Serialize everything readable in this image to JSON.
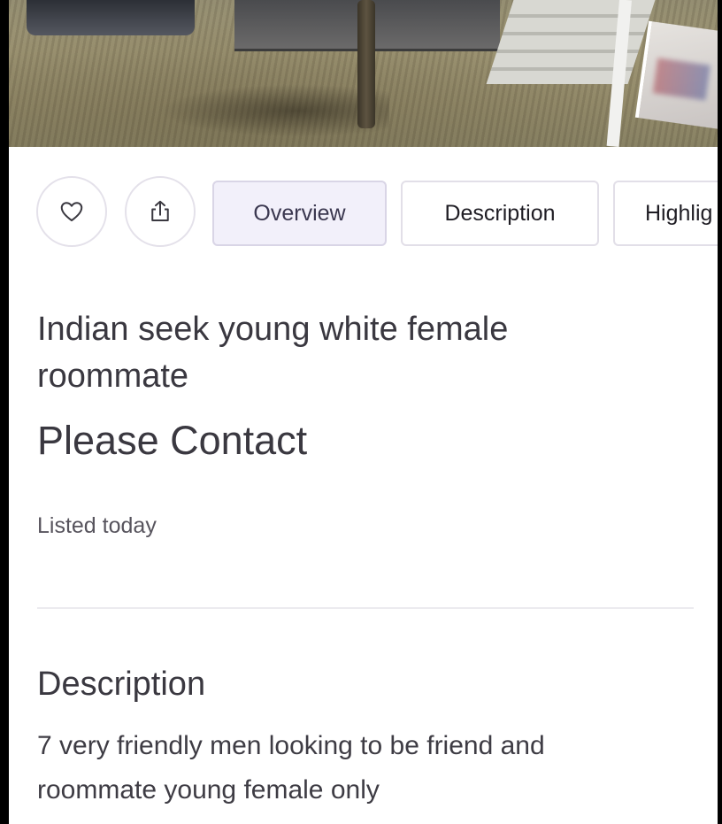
{
  "listing": {
    "title": "Indian seek young white female roommate",
    "price": "Please Contact",
    "listed": "Listed today"
  },
  "toolbar": {
    "tabs": [
      "Overview",
      "Description",
      "Highlig"
    ],
    "active_tab": "Overview"
  },
  "description": {
    "heading": "Description",
    "line1": "7 very friendly men looking to be friend and",
    "line2": "roommate young female only"
  },
  "icons": {
    "save": "heart-icon",
    "share": "share-icon",
    "overlay": "play-icon"
  },
  "colors": {
    "text": "#3a3840",
    "active_tab_bg": "#f2f0fa",
    "border": "#e2dfe8"
  }
}
